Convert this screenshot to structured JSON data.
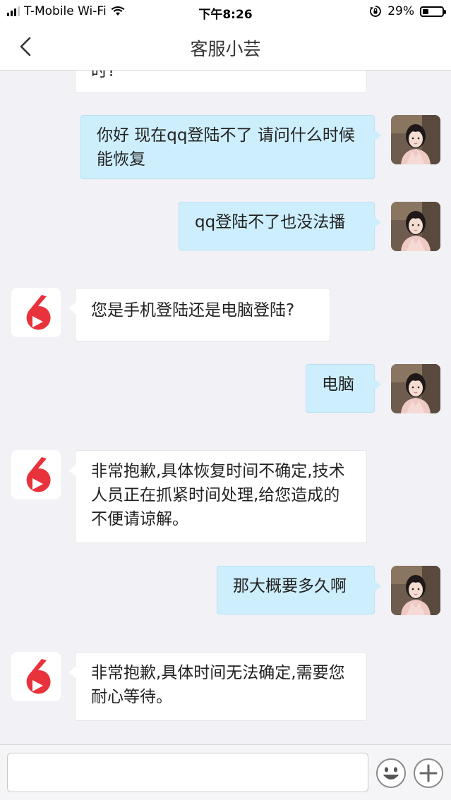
{
  "status_bar": {
    "carrier": "T-Mobile Wi-Fi",
    "time": "下午8:26",
    "battery": "29%",
    "battery_level": 0.29
  },
  "header": {
    "title": "客服小芸",
    "back_icon": "chevron-left-icon"
  },
  "messages": [
    {
      "from": "agent",
      "text": "时?"
    },
    {
      "from": "user",
      "text": "你好 现在qq登陆不了 请问什么时候能恢复"
    },
    {
      "from": "user",
      "text": "qq登陆不了也没法播"
    },
    {
      "from": "agent",
      "text": "您是手机登陆还是电脑登陆?"
    },
    {
      "from": "user",
      "text": "电脑"
    },
    {
      "from": "agent",
      "text": "非常抱歉,具体恢复时间不确定,技术人员正在抓紧时间处理,给您造成的不便请谅解。"
    },
    {
      "from": "user",
      "text": "那大概要多久啊"
    },
    {
      "from": "agent",
      "text": "非常抱歉,具体时间无法确定,需要您耐心等待。"
    }
  ],
  "input": {
    "placeholder": "",
    "value": ""
  },
  "icons": {
    "emoji": "smiley-icon",
    "plus": "plus-icon"
  },
  "colors": {
    "brand_red": "#e8323c",
    "user_bubble": "#cdeefc",
    "agent_bubble": "#ffffff"
  }
}
